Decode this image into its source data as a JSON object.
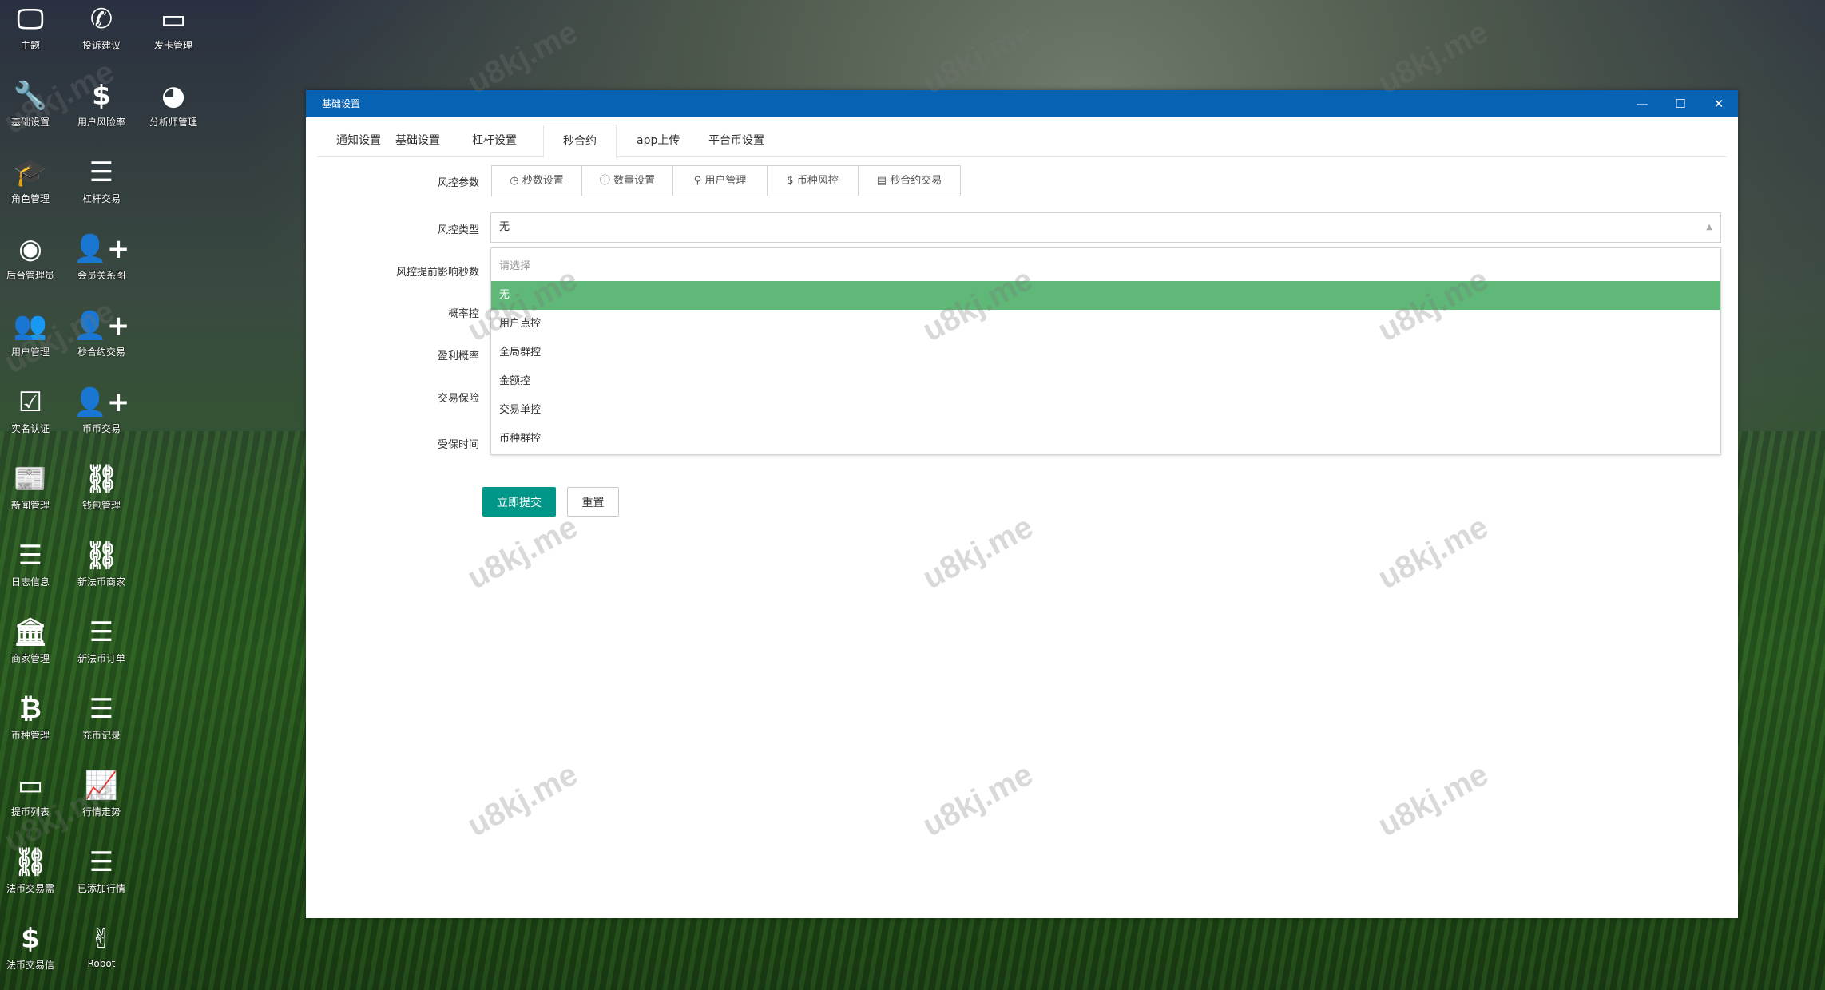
{
  "desktop": {
    "icons": [
      {
        "label": "主题",
        "icon": "monitor-icon",
        "glyph": "🖵",
        "col": 0,
        "row": 0
      },
      {
        "label": "投诉建议",
        "icon": "phone-icon",
        "glyph": "✆",
        "col": 1,
        "row": 0
      },
      {
        "label": "发卡管理",
        "icon": "credit-card-icon",
        "glyph": "▭",
        "col": 2,
        "row": 0
      },
      {
        "label": "基础设置",
        "icon": "wrench-icon",
        "glyph": "🔧",
        "col": 0,
        "row": 1
      },
      {
        "label": "用户风险率",
        "icon": "dollar-icon",
        "glyph": "$",
        "col": 1,
        "row": 1
      },
      {
        "label": "分析师管理",
        "icon": "pie-chart-icon",
        "glyph": "◕",
        "col": 2,
        "row": 1
      },
      {
        "label": "角色管理",
        "icon": "graduation-cap-icon",
        "glyph": "🎓",
        "col": 0,
        "row": 2
      },
      {
        "label": "杠杆交易",
        "icon": "list-icon",
        "glyph": "☰",
        "col": 1,
        "row": 2
      },
      {
        "label": "后台管理员",
        "icon": "user-circle-icon",
        "glyph": "◉",
        "col": 0,
        "row": 3
      },
      {
        "label": "会员关系图",
        "icon": "user-plus-icon",
        "glyph": "👤+",
        "col": 1,
        "row": 3
      },
      {
        "label": "用户管理",
        "icon": "users-icon",
        "glyph": "👥",
        "col": 0,
        "row": 4
      },
      {
        "label": "秒合约交易",
        "icon": "user-plus-icon",
        "glyph": "👤+",
        "col": 1,
        "row": 4
      },
      {
        "label": "实名认证",
        "icon": "check-square-icon",
        "glyph": "☑",
        "col": 0,
        "row": 5
      },
      {
        "label": "币币交易",
        "icon": "user-plus-icon",
        "glyph": "👤+",
        "col": 1,
        "row": 5
      },
      {
        "label": "新闻管理",
        "icon": "newspaper-icon",
        "glyph": "📰",
        "col": 0,
        "row": 6
      },
      {
        "label": "钱包管理",
        "icon": "link-circle-icon",
        "glyph": "⛓",
        "col": 1,
        "row": 6
      },
      {
        "label": "日志信息",
        "icon": "list-icon",
        "glyph": "☰",
        "col": 0,
        "row": 7
      },
      {
        "label": "新法币商家",
        "icon": "link-circle-icon",
        "glyph": "⛓",
        "col": 1,
        "row": 7
      },
      {
        "label": "商家管理",
        "icon": "bank-icon",
        "glyph": "🏛",
        "col": 0,
        "row": 8
      },
      {
        "label": "新法币订单",
        "icon": "list-icon",
        "glyph": "☰",
        "col": 1,
        "row": 8
      },
      {
        "label": "币种管理",
        "icon": "bitcoin-icon",
        "glyph": "₿",
        "col": 0,
        "row": 9
      },
      {
        "label": "充币记录",
        "icon": "list-icon",
        "glyph": "☰",
        "col": 1,
        "row": 9
      },
      {
        "label": "提币列表",
        "icon": "credit-card-icon",
        "glyph": "▭",
        "col": 0,
        "row": 10
      },
      {
        "label": "行情走势",
        "icon": "line-chart-icon",
        "glyph": "📈",
        "col": 1,
        "row": 10
      },
      {
        "label": "法币交易需",
        "icon": "link-circle-icon",
        "glyph": "⛓",
        "col": 0,
        "row": 11
      },
      {
        "label": "已添加行情",
        "icon": "list-icon",
        "glyph": "☰",
        "col": 1,
        "row": 11
      },
      {
        "label": "法币交易信",
        "icon": "dollar-icon",
        "glyph": "$",
        "col": 0,
        "row": 12
      },
      {
        "label": "Robot",
        "icon": "hand-icon",
        "glyph": "✌",
        "col": 1,
        "row": 12
      }
    ]
  },
  "window": {
    "title": "基础设置",
    "minimize": "—",
    "maximize": "☐",
    "close": "✕"
  },
  "tabs": [
    {
      "label": "通知设置"
    },
    {
      "label": "基础设置"
    },
    {
      "label": "杠杆设置"
    },
    {
      "label": "秒合约",
      "active": true
    },
    {
      "label": "app上传"
    },
    {
      "label": "平台币设置"
    }
  ],
  "form": {
    "labels": [
      "风控参数",
      "风控类型",
      "风控提前影响秒数",
      "概率控",
      "盈利概率",
      "交易保险",
      "受保时间"
    ],
    "param_buttons": [
      {
        "label": "秒数设置",
        "icon": "clock-icon",
        "glyph": "◷"
      },
      {
        "label": "数量设置",
        "icon": "info-icon",
        "glyph": "ⓘ"
      },
      {
        "label": "用户管理",
        "icon": "user-icon",
        "glyph": "⚲"
      },
      {
        "label": "币种风控",
        "icon": "dollar-circle-icon",
        "glyph": "$"
      },
      {
        "label": "秒合约交易",
        "icon": "clipboard-icon",
        "glyph": "▤"
      }
    ],
    "risk_type": {
      "value": "无",
      "arrow": "▲",
      "options": [
        {
          "label": "请选择",
          "placeholder": true
        },
        {
          "label": "无",
          "selected": true
        },
        {
          "label": "用户点控"
        },
        {
          "label": "全局群控"
        },
        {
          "label": "金额控"
        },
        {
          "label": "交易单控"
        },
        {
          "label": "币种群控"
        }
      ]
    },
    "submit": "立即提交",
    "reset": "重置"
  },
  "colors": {
    "titlebar": "#0862b4",
    "selected_option": "#5fb878",
    "submit": "#009688"
  },
  "watermark": "u8kj.me"
}
